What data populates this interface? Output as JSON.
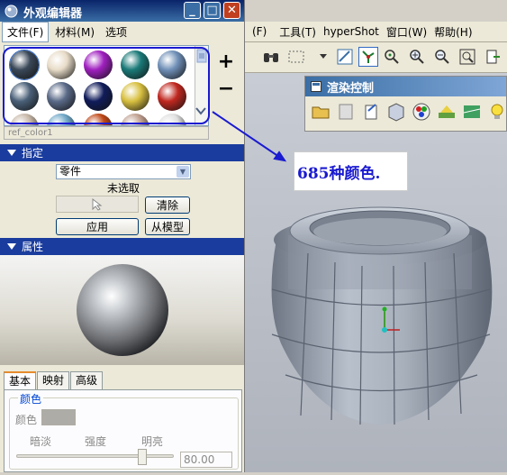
{
  "editor": {
    "title": "外观编辑器",
    "window_buttons": {
      "minimize": "_",
      "maximize": "□",
      "close": "✕"
    },
    "menu": [
      "文件(F)",
      "材料(M)",
      "选项"
    ],
    "swatch_colors": [
      [
        "#3a4858",
        "#e8dcc8",
        "#a020c0",
        "#1a7a78",
        "#7090b8"
      ],
      [
        "#4a6078",
        "#5a6a88",
        "#101c5a",
        "#d8c040",
        "#c02820"
      ],
      [
        "#c8b8a8",
        "#70a8c8",
        "#c04818",
        "#c0a090",
        "#e0e0e0"
      ]
    ],
    "material_name": "ref_color1",
    "add_label": "+",
    "remove_label": "−",
    "assign_section": {
      "title": "指定",
      "part_select": "零件",
      "selection_status": "未选取",
      "clear_button": "清除",
      "apply_button": "应用",
      "from_model_button": "从模型"
    },
    "properties_section": {
      "title": "属性"
    },
    "tabs": [
      "基本",
      "映射",
      "高级"
    ],
    "basic": {
      "group_title": "颜色",
      "color_label": "颜色",
      "slider_labels": [
        "暗淡",
        "强度",
        "明亮"
      ],
      "brightness_value": "80.00",
      "brightness_level": 0.8
    }
  },
  "cad": {
    "menu": [
      "(F)",
      "工具(T)",
      "hyperShot",
      "窗口(W)",
      "帮助(H)"
    ],
    "render_panel_title": "渲染控制"
  },
  "annotation": {
    "text": "685种颜色."
  },
  "colors": {
    "accent": "#1a1ad0",
    "section_bar": "#1a3c9e",
    "title_bar": "#0a246a"
  }
}
